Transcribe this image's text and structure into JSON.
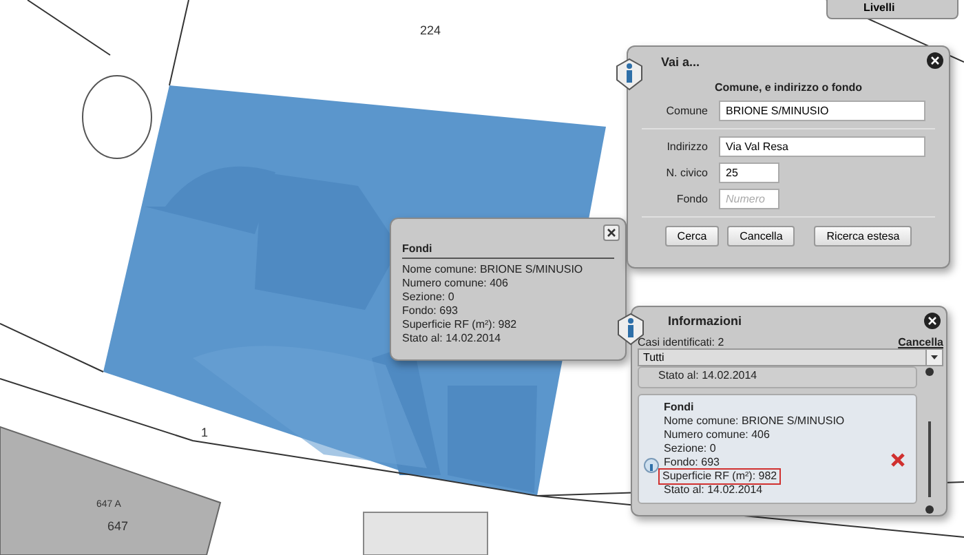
{
  "map": {
    "labels": [
      "224",
      "1",
      "647 A",
      "647"
    ]
  },
  "layers_button": {
    "label": "Livelli"
  },
  "popup": {
    "title": "Fondi",
    "lines": [
      "Nome comune: BRIONE S/MINUSIO",
      "Numero comune: 406",
      "Sezione: 0",
      "Fondo: 693",
      "Superficie RF (m²): 982",
      "Stato al: 14.02.2014"
    ]
  },
  "goto_panel": {
    "title": "Vai a...",
    "heading": "Comune, e indirizzo o fondo",
    "fields": [
      {
        "label": "Comune",
        "value": "BRIONE S/MINUSIO",
        "kind": "wide"
      },
      {
        "label": "Indirizzo",
        "value": "Via Val Resa",
        "kind": "wide"
      },
      {
        "label": "N. civico",
        "value": "25",
        "kind": "short"
      },
      {
        "label": "Fondo",
        "placeholder": "Numero",
        "kind": "short"
      }
    ],
    "buttons": [
      "Cerca",
      "Cancella",
      "Ricerca estesa"
    ]
  },
  "info_panel": {
    "title": "Informazioni",
    "count": "Casi identificati: 2",
    "clear": "Cancella",
    "filter": "Tutti",
    "previous_line": "Stato al: 14.02.2014",
    "result": {
      "title": "Fondi",
      "lines": [
        {
          "text": "Nome comune: BRIONE S/MINUSIO",
          "highlighted": false
        },
        {
          "text": "Numero comune: 406",
          "highlighted": false
        },
        {
          "text": "Sezione: 0",
          "highlighted": false
        },
        {
          "text": "Fondo: 693",
          "highlighted": false
        },
        {
          "text": "Superficie RF (m²): 982",
          "highlighted": true
        },
        {
          "text": "Stato al: 14.02.2014",
          "highlighted": false
        }
      ]
    }
  }
}
